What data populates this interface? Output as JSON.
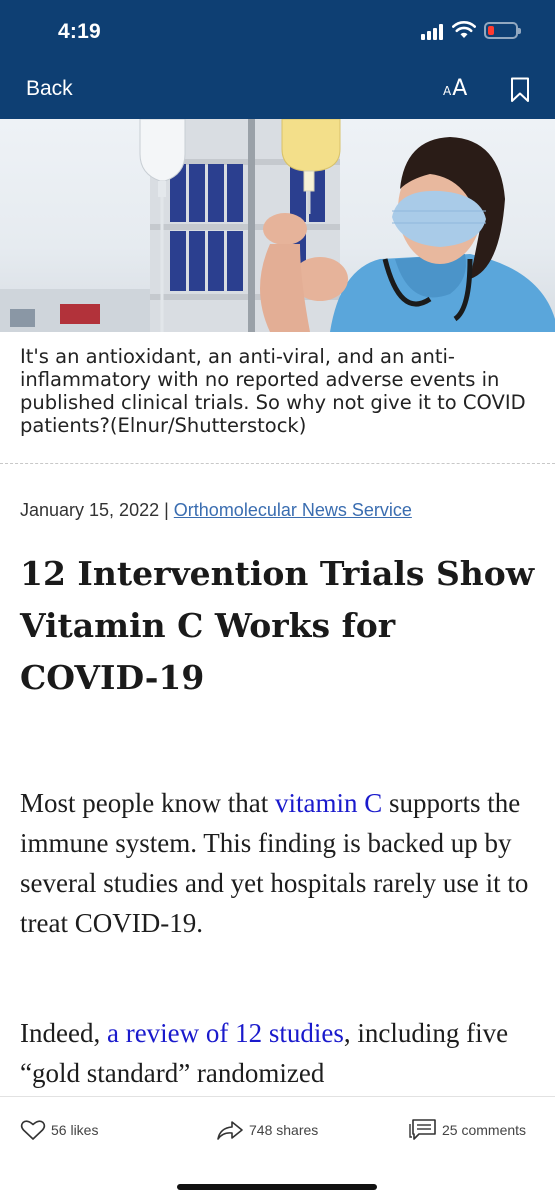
{
  "status_bar": {
    "time": "4:19",
    "signal_icon": "signal-bars-icon",
    "wifi_icon": "wifi-icon",
    "battery_icon": "battery-low-icon",
    "battery_color": "#ff3b30"
  },
  "nav": {
    "back_label": "Back",
    "text_size_small": "A",
    "text_size_large": "A",
    "bookmark_icon": "bookmark-icon",
    "bg_color": "#0e3f73"
  },
  "hero": {
    "caption": "It's an antioxidant, an anti-viral, and an anti-inflammatory with no reported adverse events in published clinical trials. So why not give it to COVID patients?(Elnur/Shutterstock)"
  },
  "article": {
    "date": "January 15, 2022",
    "separator": "|",
    "source": "Orthomolecular News Service",
    "title": "12 Intervention Trials Show Vitamin C Works for COVID-19",
    "p1_text_a": "Most people know that ",
    "p1_link": "vitamin C",
    "p1_text_b": " supports the immune system. This finding is backed up by several studies and yet hospitals rarely use it to treat COVID-19.",
    "p2_text_a": "Indeed, ",
    "p2_link": "a review of 12 studies",
    "p2_text_b": ", including five “gold standard” randomized",
    "link_color": "#1a1acc"
  },
  "actions": {
    "likes": "56 likes",
    "shares": "748 shares",
    "comments": "25 comments",
    "likes_icon": "heart-icon",
    "shares_icon": "share-arrow-icon",
    "comments_icon": "comment-icon"
  }
}
